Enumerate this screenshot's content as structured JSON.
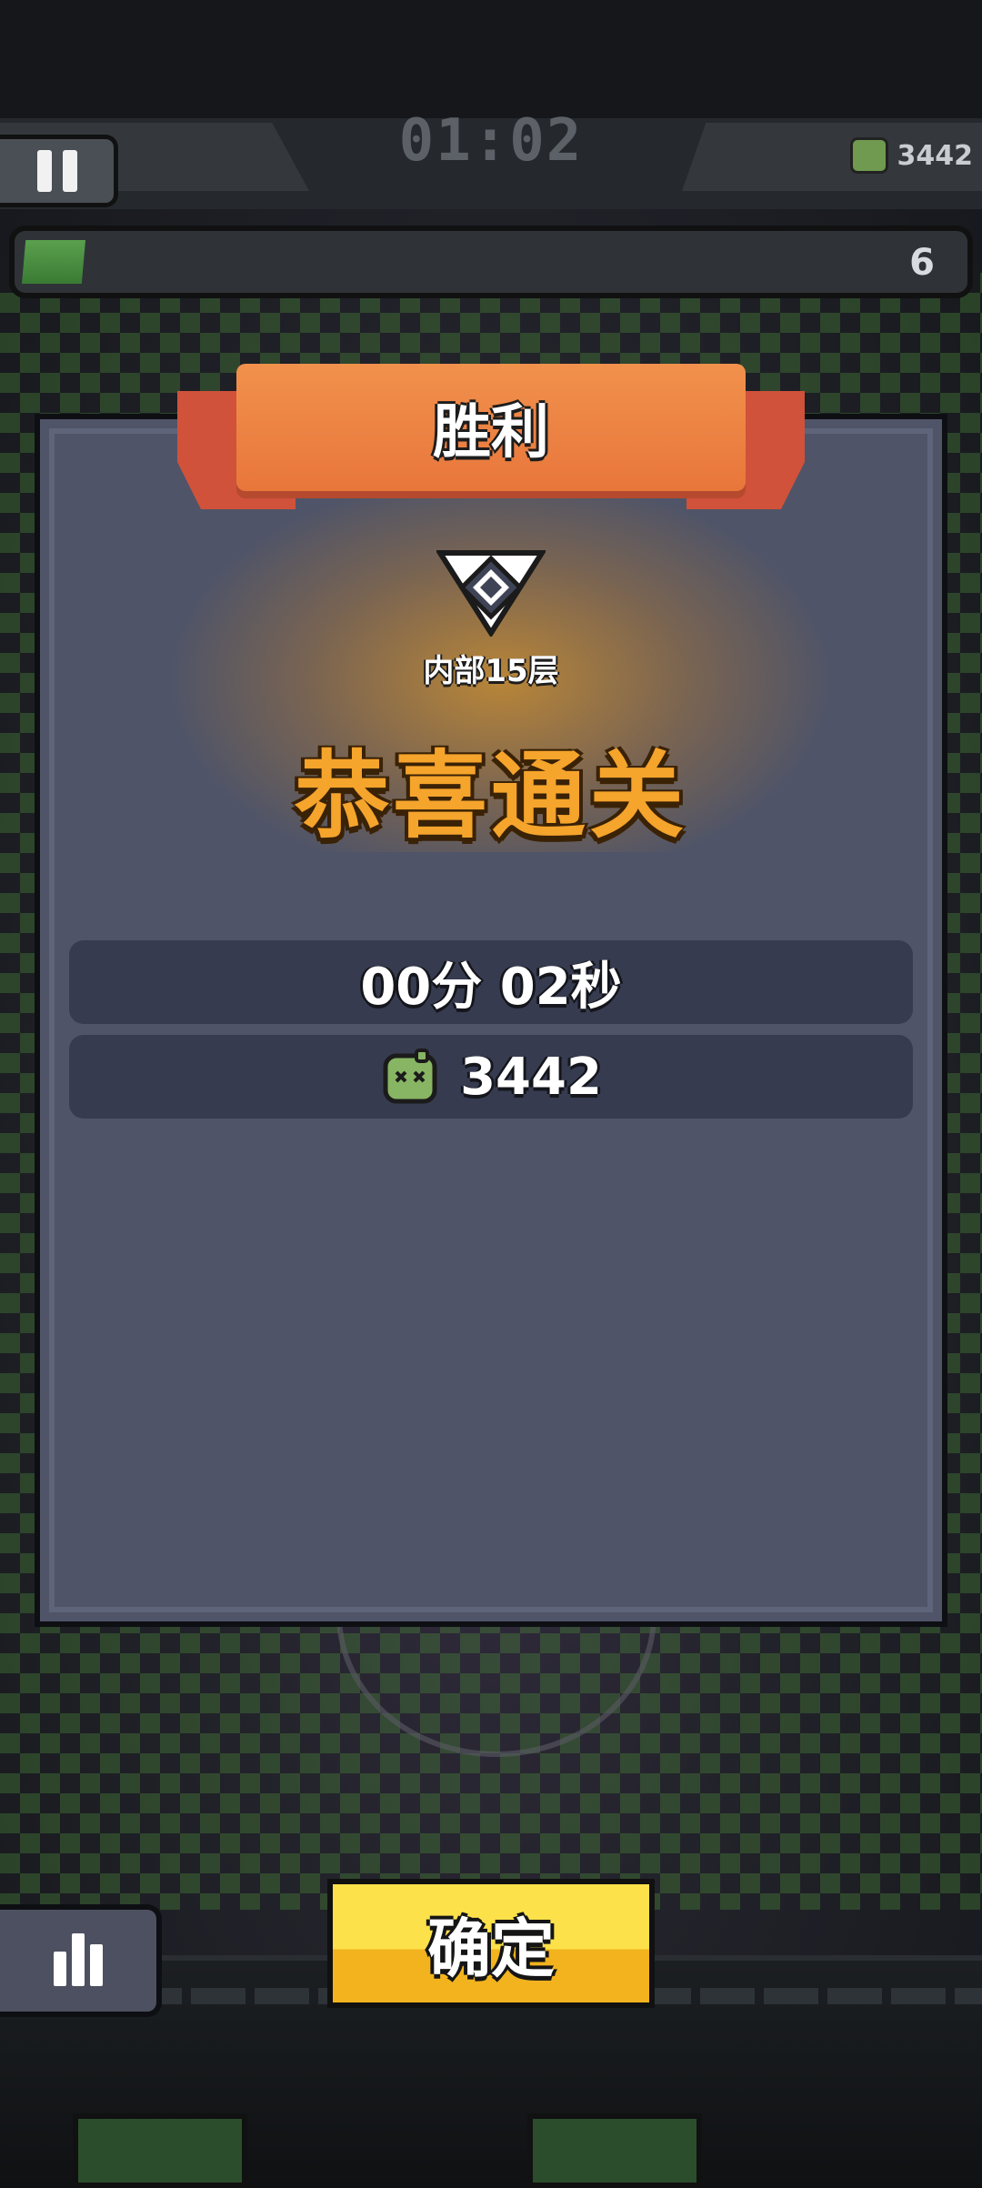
{
  "hud": {
    "timer": "01:02",
    "kill_count": "3442",
    "level": "6",
    "xp_progress": 0.04
  },
  "result": {
    "title": "胜利",
    "floor": "内部15层",
    "headline": "恭喜通关",
    "time": "00分 02秒",
    "kills": "3442"
  },
  "buttons": {
    "confirm": "确定"
  },
  "colors": {
    "headline": "#f5a42c",
    "ribbon": "#e8763b",
    "confirm": "#fde14a"
  },
  "icons": [
    "pause-icon",
    "slime-icon",
    "rank-badge-icon",
    "bar-chart-icon"
  ]
}
